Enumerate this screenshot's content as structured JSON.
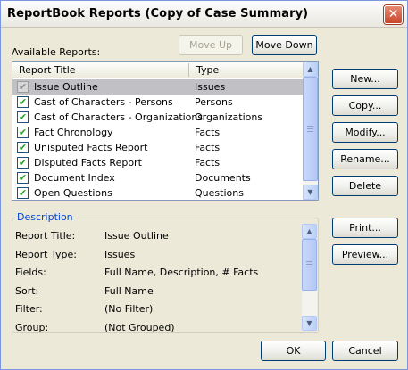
{
  "window": {
    "title": "ReportBook Reports (Copy of Case Summary)",
    "close_glyph": "✕"
  },
  "available_reports": {
    "label": "Available Reports:",
    "move_up_label": "Move Up",
    "move_down_label": "Move Down",
    "columns": [
      "Report Title",
      "Type"
    ],
    "rows": [
      {
        "title": "Issue Outline",
        "type": "Issues",
        "checked": true,
        "selected": true
      },
      {
        "title": "Cast of Characters - Persons",
        "type": "Persons",
        "checked": true,
        "selected": false
      },
      {
        "title": "Cast of Characters - Organizations",
        "type": "Organizations",
        "checked": true,
        "selected": false
      },
      {
        "title": "Fact Chronology",
        "type": "Facts",
        "checked": true,
        "selected": false
      },
      {
        "title": "Unisputed Facts Report",
        "type": "Facts",
        "checked": true,
        "selected": false
      },
      {
        "title": "Disputed Facts Report",
        "type": "Facts",
        "checked": true,
        "selected": false
      },
      {
        "title": "Document Index",
        "type": "Documents",
        "checked": true,
        "selected": false
      },
      {
        "title": "Open Questions",
        "type": "Questions",
        "checked": true,
        "selected": false
      }
    ]
  },
  "side_buttons": {
    "new": "New...",
    "copy": "Copy...",
    "modify": "Modify...",
    "rename": "Rename...",
    "delete": "Delete",
    "print": "Print...",
    "preview": "Preview..."
  },
  "description": {
    "title": "Description",
    "rows": [
      {
        "key": "Report Title:",
        "value": "Issue Outline"
      },
      {
        "key": "Report Type:",
        "value": "Issues"
      },
      {
        "key": "Fields:",
        "value": "Full Name, Description, # Facts"
      },
      {
        "key": "Sort:",
        "value": "Full Name"
      },
      {
        "key": "Filter:",
        "value": "(No Filter)"
      },
      {
        "key": "Group:",
        "value": "(Not Grouped)"
      }
    ]
  },
  "footer": {
    "ok": "OK",
    "cancel": "Cancel"
  },
  "icons": {
    "check": "check-icon",
    "scroll_up": "▲",
    "scroll_down": "▼"
  },
  "colors": {
    "dialog_bg": "#ece9d8",
    "selection_bg": "#c1c0c4",
    "group_title": "#0046d5",
    "button_border": "#003c74"
  }
}
